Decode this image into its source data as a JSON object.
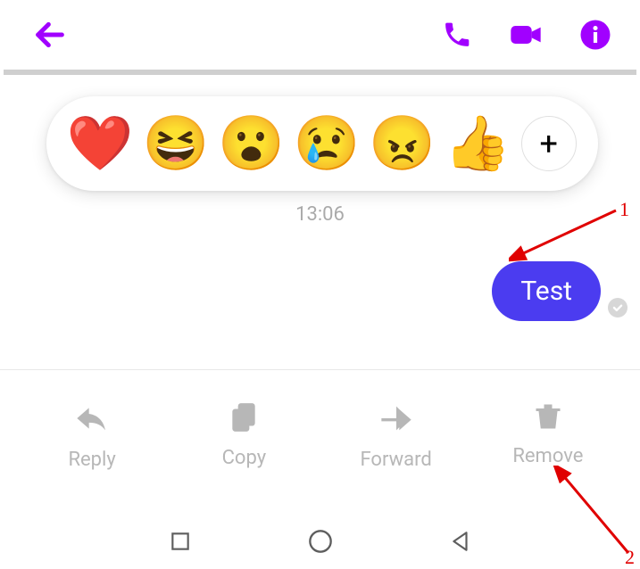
{
  "header": {
    "accent_color": "#a100ff"
  },
  "reactions": {
    "items": [
      "❤️",
      "😆",
      "😮",
      "😢",
      "😠",
      "👍"
    ],
    "add_label": "+"
  },
  "chat": {
    "timestamp": "13:06",
    "message": "Test"
  },
  "actions": {
    "reply": "Reply",
    "copy": "Copy",
    "forward": "Forward",
    "remove": "Remove"
  },
  "annotations": {
    "label1": "1",
    "label2": "2"
  }
}
